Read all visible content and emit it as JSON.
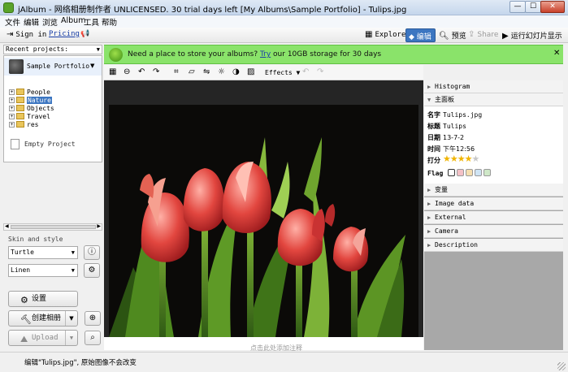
{
  "window": {
    "title": "jAlbum - 网络相册制作者 UNLICENSED. 30 trial days left [My Albums\\Sample Portfolio] - Tulips.jpg",
    "controls": {
      "minimize": "—",
      "maximize": "☐",
      "close": "✕"
    }
  },
  "menu": [
    "文件",
    "编辑",
    "浏览",
    "Album",
    "工具",
    "帮助"
  ],
  "toolbar": {
    "sign_in": "Sign in",
    "pricing": "Pricing",
    "explore": "Explore",
    "edit": "编辑",
    "preview": "预览",
    "share": "Share",
    "slideshow": "运行幻灯片显示"
  },
  "left": {
    "recent_label": "Recent projects:",
    "project_name": "Sample Portfolio",
    "tree": [
      {
        "label": "People",
        "selected": false
      },
      {
        "label": "Nature",
        "selected": true
      },
      {
        "label": "Objects",
        "selected": false
      },
      {
        "label": "Travel",
        "selected": false
      },
      {
        "label": "res",
        "selected": false
      }
    ],
    "empty_project": "Empty Project",
    "skin_and_style": "Skin and style",
    "skin": "Turtle",
    "style": "Linen",
    "settings_btn": "设置",
    "make_album_btn": "创建相册",
    "upload_btn": "Upload"
  },
  "banner": {
    "text_before": "Need a place to store your albums? ",
    "link": "Try",
    "text_after": " our 10GB storage for 30 days",
    "close": "✕"
  },
  "edit_bar": {
    "effects": "Effects"
  },
  "viewer": {
    "caption": "点击此处添加注释",
    "bg": "#252525"
  },
  "right": {
    "sections": [
      "Histogram",
      "主面板",
      "变量",
      "Image data",
      "External",
      "Camera",
      "Description"
    ],
    "info": {
      "name_key": "名字",
      "name_val": "Tulips.jpg",
      "title_key": "标题",
      "title_val": "Tulips",
      "date_key": "日期",
      "date_val": "13-7-2",
      "time_key": "时间",
      "time_val": "下午12:56",
      "rating_key": "打分",
      "rating_stars": 4,
      "rating_max": 5,
      "flag_key": "Flag"
    },
    "flag_colors": [
      "#ffffff",
      "#f4c1c6",
      "#f5dfb0",
      "#cfe4f4",
      "#cfe8c8"
    ]
  },
  "status": {
    "text": "编辑\"Tulips.jpg\", 原始图像不会改变"
  }
}
